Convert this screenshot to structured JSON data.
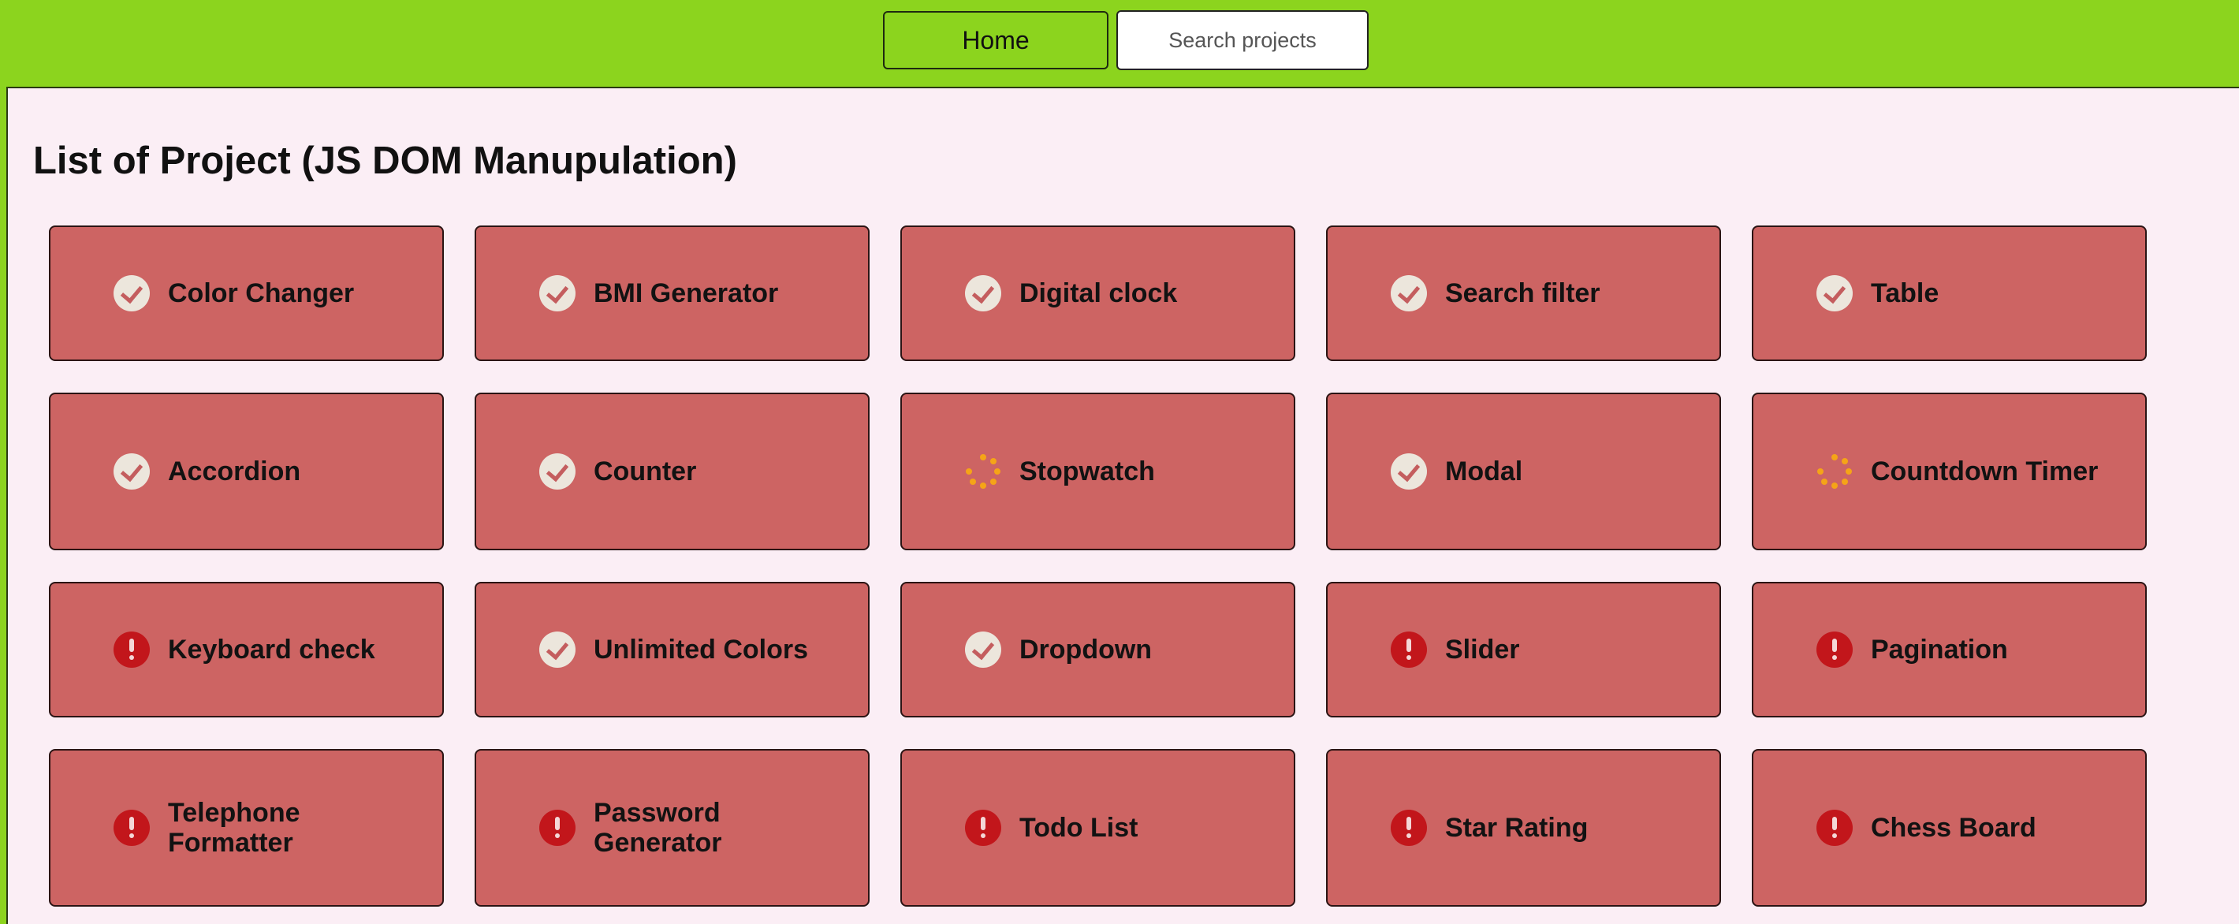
{
  "nav": {
    "home_label": "Home",
    "search_placeholder": "Search projects"
  },
  "page_title": "List of Project (JS DOM Manupulation)",
  "projects": [
    {
      "label": "Color Changer",
      "status": "check-icon"
    },
    {
      "label": "BMI Generator",
      "status": "check-icon"
    },
    {
      "label": "Digital clock",
      "status": "check-icon"
    },
    {
      "label": "Search filter",
      "status": "check-icon"
    },
    {
      "label": "Table",
      "status": "check-icon"
    },
    {
      "label": "Accordion",
      "status": "check-icon"
    },
    {
      "label": "Counter",
      "status": "check-icon"
    },
    {
      "label": "Stopwatch",
      "status": "spinner-icon"
    },
    {
      "label": "Modal",
      "status": "check-icon"
    },
    {
      "label": "Countdown Timer",
      "status": "spinner-icon"
    },
    {
      "label": "Keyboard check",
      "status": "alert-icon"
    },
    {
      "label": "Unlimited Colors",
      "status": "check-icon"
    },
    {
      "label": "Dropdown",
      "status": "check-icon"
    },
    {
      "label": "Slider",
      "status": "alert-icon"
    },
    {
      "label": "Pagination",
      "status": "alert-icon"
    },
    {
      "label": "Telephone Formatter",
      "status": "alert-icon"
    },
    {
      "label": "Password Generator",
      "status": "alert-icon"
    },
    {
      "label": "Todo List",
      "status": "alert-icon"
    },
    {
      "label": "Star Rating",
      "status": "alert-icon"
    },
    {
      "label": "Chess Board",
      "status": "alert-icon"
    }
  ],
  "colors": {
    "topbar": "#8cd41e",
    "panel": "#fbeef5",
    "card": "#cd6463",
    "check": "#ece6dc",
    "alert": "#c2161b",
    "spinner": "#f5a417"
  }
}
